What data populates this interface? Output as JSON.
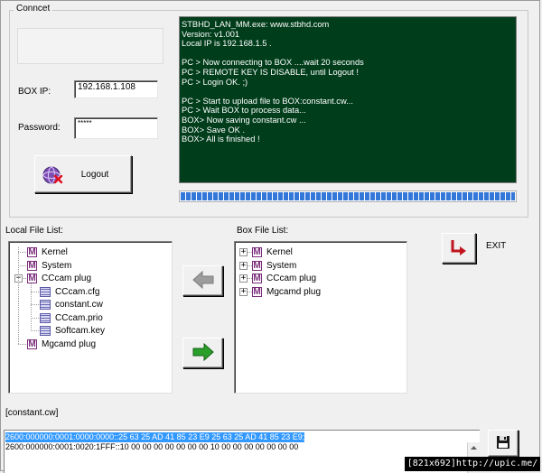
{
  "connect": {
    "title": "Conncet",
    "box_ip_label": "BOX IP:",
    "box_ip_value": "192.168.1.108",
    "password_label": "Password:",
    "password_value": "*****",
    "logout_label": "Logout"
  },
  "console_lines": [
    "STBHD_LAN_MM.exe: www.stbhd.com",
    "Version: v1.001",
    "Local IP is 192.168.1.5 .",
    "",
    "PC > Now connecting to BOX ....wait 20 seconds",
    "PC > REMOTE KEY IS DISABLE, until Logout !",
    "PC > Login OK. ;)",
    "",
    "PC > Start to upload file to BOX:constant.cw...",
    "PC > Wait BOX to process data...",
    "BOX> Now saving constant.cw ...",
    "BOX> Save OK .",
    "BOX> All is finished !"
  ],
  "progress": {
    "value": 1.0
  },
  "local_list": {
    "label": "Local File List:",
    "items": [
      {
        "name": "Kernel",
        "icon": "m-icon",
        "level": 0
      },
      {
        "name": "System",
        "icon": "m-icon",
        "level": 0
      },
      {
        "name": "CCcam plug",
        "icon": "m-icon",
        "level": 0,
        "expanded": true
      },
      {
        "name": "CCcam.cfg",
        "icon": "file-icon",
        "level": 1
      },
      {
        "name": "constant.cw",
        "icon": "file-icon",
        "level": 1
      },
      {
        "name": "CCcam.prio",
        "icon": "file-icon",
        "level": 1
      },
      {
        "name": "Softcam.key",
        "icon": "file-icon",
        "level": 1
      },
      {
        "name": "Mgcamd plug",
        "icon": "m-icon",
        "level": 0
      }
    ]
  },
  "box_list": {
    "label": "Box File List:",
    "items": [
      {
        "name": "Kernel",
        "icon": "m-icon",
        "collapsed": true
      },
      {
        "name": "System",
        "icon": "m-icon",
        "collapsed": true
      },
      {
        "name": "CCcam plug",
        "icon": "m-icon",
        "collapsed": true
      },
      {
        "name": "Mgcamd plug",
        "icon": "m-icon",
        "collapsed": true
      }
    ]
  },
  "exit": {
    "label": "EXIT"
  },
  "current_file": "[constant.cw]",
  "hex_lines": [
    "2600:000000:0001:0000:0000::25 63 25 AD 41 85 23 E9 25 63 25 AD 41 85 23 E9;",
    "2600:000000:0001:0020:1FFF::10 00 00 00 00 00 00 00 10 00 00 00 00 00 00 00"
  ],
  "watermark": "[821x692]http://upic.me/",
  "colors": {
    "console_bg": "#003d1b",
    "progress": "#3378d9",
    "plugin_icon": "#7a2c7a",
    "exit_arrow": "#c0141e",
    "arrow_right": "#2aa02a",
    "selection": "#3399ff"
  }
}
